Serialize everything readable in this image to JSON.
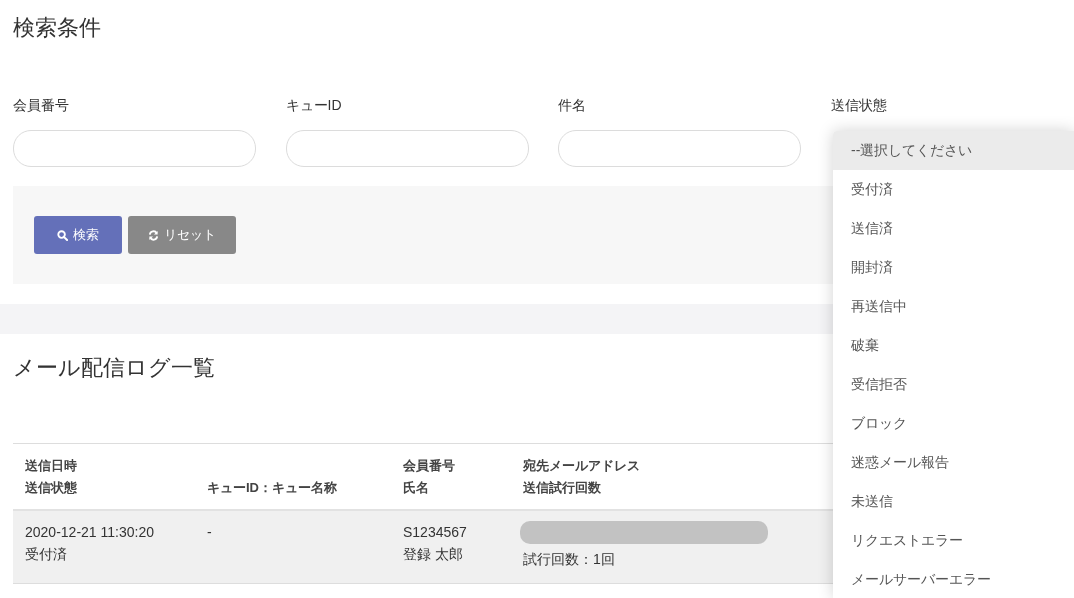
{
  "search": {
    "title": "検索条件",
    "fields": [
      {
        "label": "会員番号"
      },
      {
        "label": "キューID"
      },
      {
        "label": "件名"
      }
    ],
    "status_field": {
      "label": "送信状態"
    },
    "buttons": [
      {
        "kind": "search",
        "label": "検索"
      },
      {
        "kind": "reset",
        "label": "リセット"
      }
    ]
  },
  "dropdown": {
    "options": [
      {
        "label": "--選択してください",
        "selected": true
      },
      {
        "label": "受付済",
        "selected": false
      },
      {
        "label": "送信済",
        "selected": false
      },
      {
        "label": "開封済",
        "selected": false
      },
      {
        "label": "再送信中",
        "selected": false
      },
      {
        "label": "破棄",
        "selected": false
      },
      {
        "label": "受信拒否",
        "selected": false
      },
      {
        "label": "ブロック",
        "selected": false
      },
      {
        "label": "迷惑メール報告",
        "selected": false
      },
      {
        "label": "未送信",
        "selected": false
      },
      {
        "label": "リクエストエラー",
        "selected": false
      },
      {
        "label": "メールサーバーエラー",
        "selected": false
      }
    ]
  },
  "log": {
    "title": "メール配信ログ一覧",
    "columns": [
      {
        "lines": [
          "送信日時",
          "送信状態"
        ]
      },
      {
        "lines": [
          "キューID：キュー名称"
        ]
      },
      {
        "lines": [
          "会員番号",
          "氏名"
        ]
      },
      {
        "lines": [
          "宛先メールアドレス",
          "送信試行回数"
        ]
      }
    ],
    "rows": [
      {
        "datetime": "2020-12-21 11:30:20",
        "status": "受付済",
        "queue": "-",
        "member_no": "S1234567",
        "name": "登録 太郎",
        "email_redacted": true,
        "attempts": "試行回数：1回"
      }
    ]
  }
}
